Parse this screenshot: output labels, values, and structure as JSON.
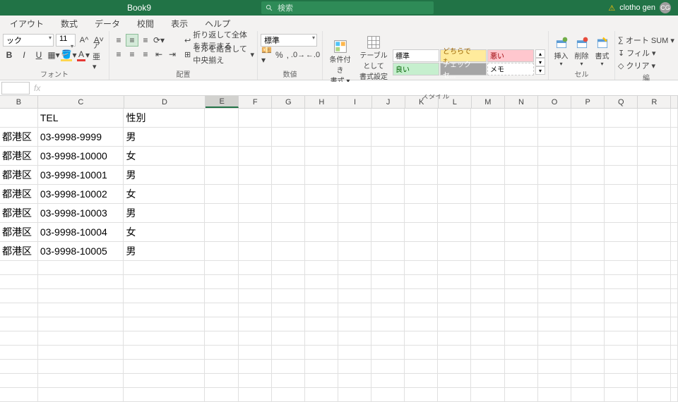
{
  "title": "Book9",
  "search_placeholder": "検索",
  "user": {
    "name": "clotho gen",
    "initials": "CG"
  },
  "tabs": [
    "イアウト",
    "数式",
    "データ",
    "校閲",
    "表示",
    "ヘルプ"
  ],
  "groups": {
    "font": "フォント",
    "align": "配置",
    "number": "数値",
    "styles": "スタイル",
    "cells": "セル",
    "editing": "編"
  },
  "font": {
    "name": "ック",
    "size": "11",
    "labels": {
      "bold": "B",
      "italic": "I",
      "underline": "U",
      "grow": "A",
      "shrink": "A"
    }
  },
  "align": {
    "wrap": "折り返して全体を表示する",
    "merge": "セルを結合して中央揃え"
  },
  "number": {
    "format": "標準"
  },
  "styles": {
    "cond": "条件付き\n書式 ▾",
    "table": "テーブルとして\n書式設定 ▾",
    "cells": [
      "標準",
      "どちらでも...",
      "悪い",
      "良い",
      "チェック セ...",
      "メモ"
    ]
  },
  "cells_btns": {
    "insert": "挿入",
    "delete": "削除",
    "format": "書式"
  },
  "editing": {
    "sum": "オート SUM",
    "fill": "フィル",
    "clear": "クリア"
  },
  "columns": [
    "B",
    "C",
    "D",
    "E",
    "F",
    "G",
    "H",
    "I",
    "J",
    "K",
    "L",
    "M",
    "N",
    "O",
    "P",
    "Q",
    "R"
  ],
  "selected_col": "E",
  "data": {
    "headers": {
      "B": "",
      "C": "TEL",
      "D": "性別"
    },
    "rows": [
      {
        "B": "都港区",
        "C": "03-9998-9999",
        "D": "男"
      },
      {
        "B": "都港区",
        "C": "03-9998-10000",
        "D": "女"
      },
      {
        "B": "都港区",
        "C": "03-9998-10001",
        "D": "男"
      },
      {
        "B": "都港区",
        "C": "03-9998-10002",
        "D": "女"
      },
      {
        "B": "都港区",
        "C": "03-9998-10003",
        "D": "男"
      },
      {
        "B": "都港区",
        "C": "03-9998-10004",
        "D": "女"
      },
      {
        "B": "都港区",
        "C": "03-9998-10005",
        "D": "男"
      }
    ]
  }
}
